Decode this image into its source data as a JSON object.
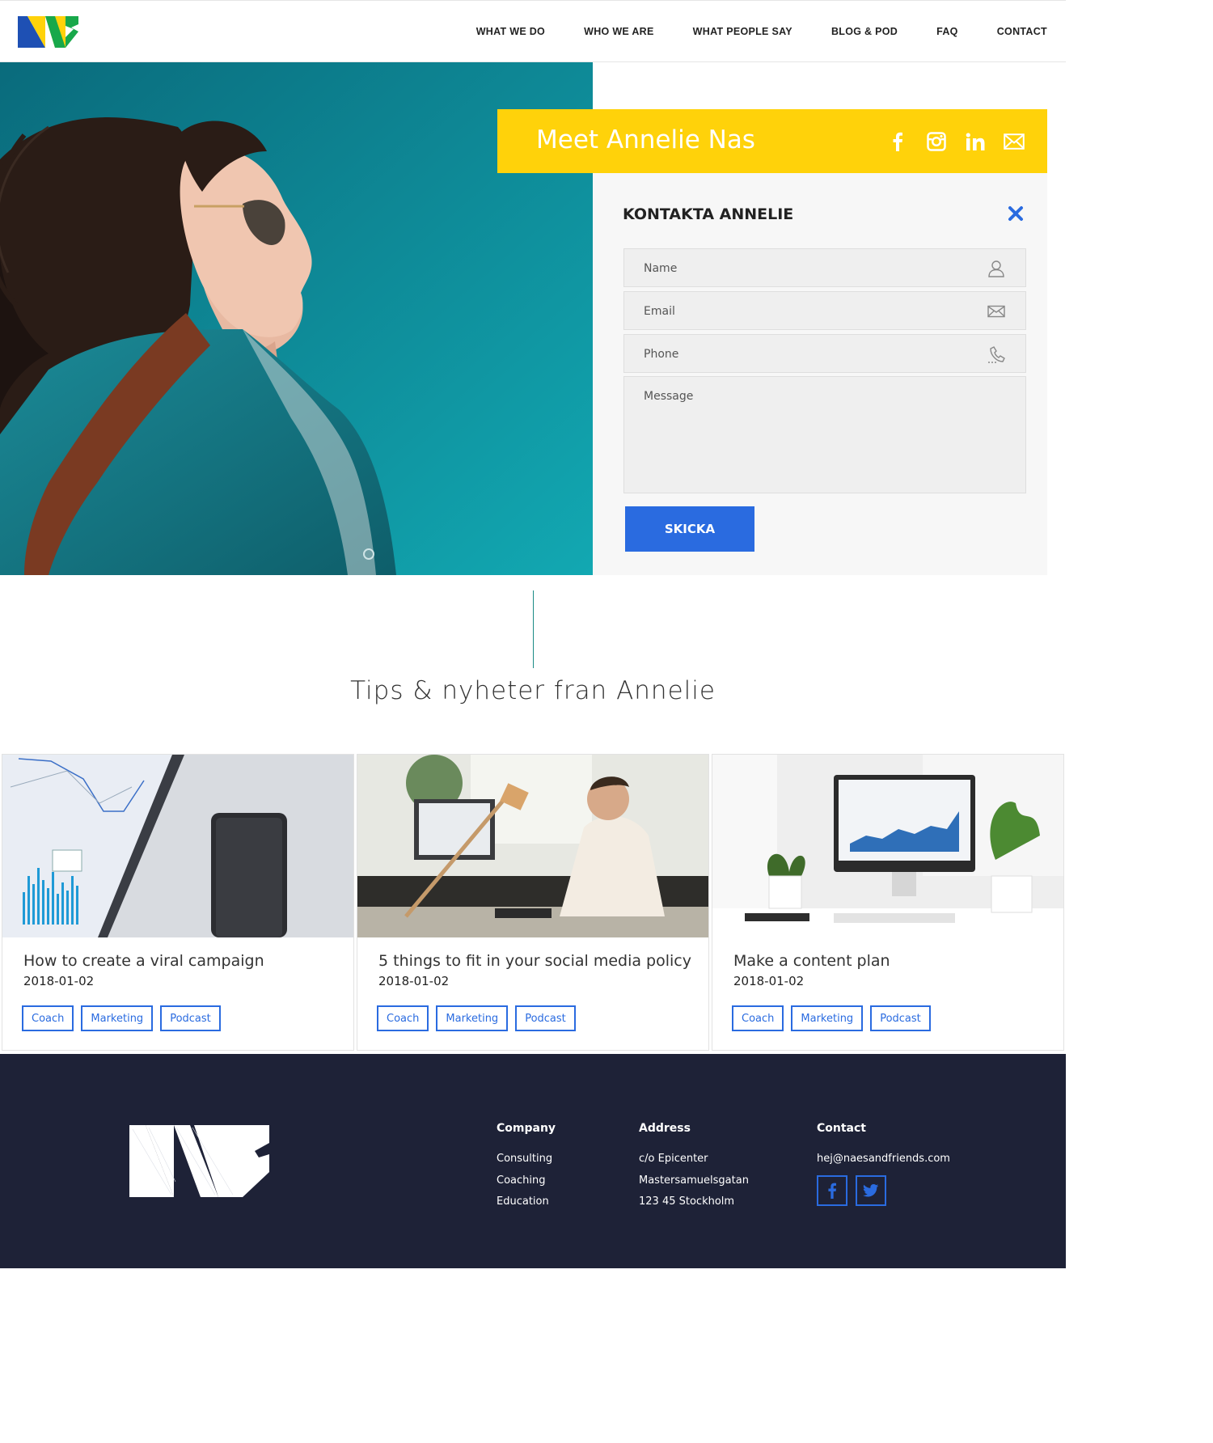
{
  "header": {
    "logo_text": "NF",
    "nav": [
      "WHAT WE DO",
      "WHO WE ARE",
      "WHAT PEOPLE SAY",
      "BLOG & POD",
      "FAQ",
      "CONTACT"
    ]
  },
  "hero": {
    "banner_title": "Meet Annelie Nas",
    "social_icons": [
      "facebook-icon",
      "instagram-icon",
      "linkedin-icon",
      "mail-icon"
    ],
    "slider": {
      "count": 3,
      "active": 1
    }
  },
  "contact_form": {
    "title": "KONTAKTA ANNELIE",
    "fields": {
      "name": {
        "placeholder": "Name",
        "value": ""
      },
      "email": {
        "placeholder": "Email",
        "value": ""
      },
      "phone": {
        "placeholder": "Phone",
        "value": ""
      },
      "message": {
        "placeholder": "Message",
        "value": ""
      }
    },
    "submit_label": "SKICKA"
  },
  "tips": {
    "title": "Tips & nyheter fran Annelie",
    "posts": [
      {
        "title": "How to create a viral campaign",
        "date": "2018-01-02",
        "tags": [
          "Coach",
          "Marketing",
          "Podcast"
        ]
      },
      {
        "title": "5 things to fit in your social media policy",
        "date": "2018-01-02",
        "tags": [
          "Coach",
          "Marketing",
          "Podcast"
        ]
      },
      {
        "title": "Make a content plan",
        "date": "2018-01-02",
        "tags": [
          "Coach",
          "Marketing",
          "Podcast"
        ]
      }
    ]
  },
  "footer": {
    "company": {
      "heading": "Company",
      "items": [
        "Consulting",
        "Coaching",
        "Education"
      ]
    },
    "address": {
      "heading": "Address",
      "lines": [
        "c/o Epicenter",
        "Mastersamuelsgatan",
        "123 45 Stockholm"
      ]
    },
    "contact": {
      "heading": "Contact",
      "email": "hej@naesandfriends.com",
      "social_icons": [
        "facebook-icon",
        "twitter-icon"
      ]
    }
  },
  "colors": {
    "accent_blue": "#2a6be0",
    "banner_yellow": "#ffd20a",
    "footer_bg": "#1e2237",
    "hero_teal": "#0f8696"
  }
}
